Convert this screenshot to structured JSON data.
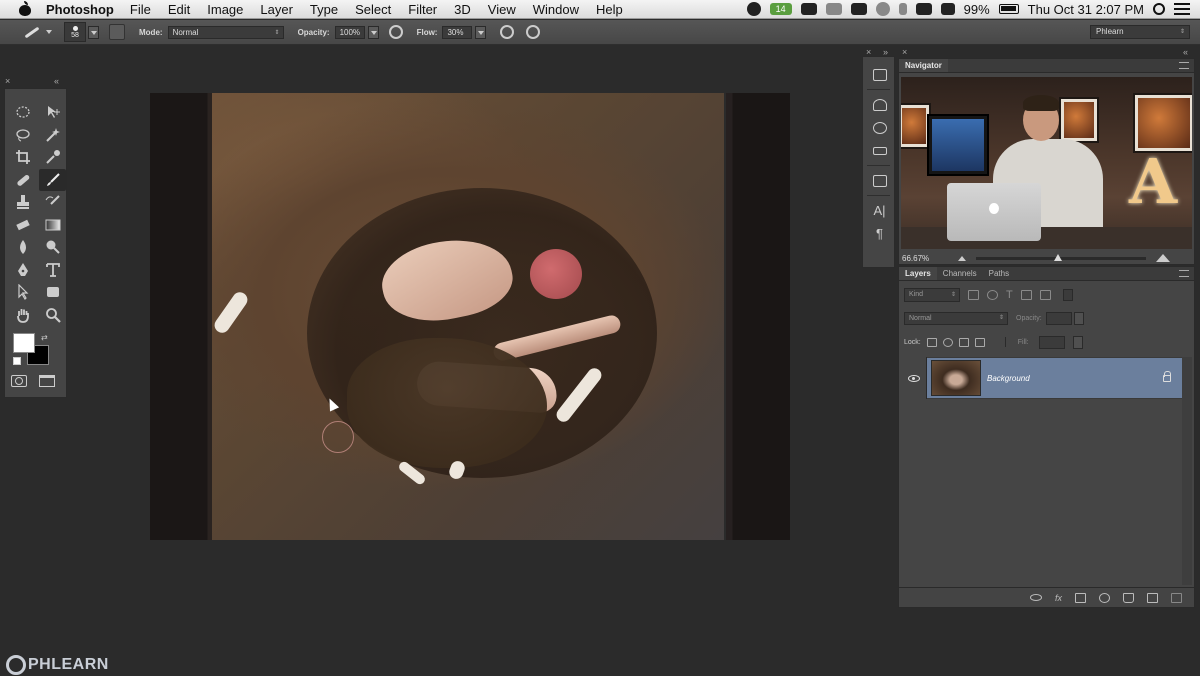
{
  "menubar": {
    "app_name": "Photoshop",
    "items": [
      "File",
      "Edit",
      "Image",
      "Layer",
      "Type",
      "Select",
      "Filter",
      "3D",
      "View",
      "Window",
      "Help"
    ],
    "status_badge": "14",
    "battery": "99%",
    "clock": "Thu Oct 31  2:07 PM"
  },
  "options": {
    "brush_size": "58",
    "mode_label": "Mode:",
    "mode_value": "Normal",
    "opacity_label": "Opacity:",
    "opacity_value": "100%",
    "flow_label": "Flow:",
    "flow_value": "30%",
    "workspace": "Phlearn"
  },
  "toolbox": {
    "tools": [
      "marquee-tool-icon",
      "move-tool-icon",
      "lasso-tool-icon",
      "magic-wand-tool-icon",
      "crop-tool-icon",
      "eyedropper-tool-icon",
      "healing-brush-tool-icon",
      "brush-tool-icon",
      "clone-stamp-tool-icon",
      "history-brush-tool-icon",
      "eraser-tool-icon",
      "gradient-tool-icon",
      "blur-tool-icon",
      "dodge-tool-icon",
      "pen-tool-icon",
      "type-tool-icon",
      "path-selection-tool-icon",
      "shape-tool-icon",
      "hand-tool-icon",
      "zoom-tool-icon"
    ],
    "active_tool": "brush-tool-icon",
    "foreground_color": "#ffffff",
    "background_color": "#000000"
  },
  "navigator": {
    "tab_label": "Navigator",
    "zoom": "66.67%",
    "zoom_slider_fraction": 0.46
  },
  "layers_panel": {
    "tabs": [
      "Layers",
      "Channels",
      "Paths"
    ],
    "kind_label": "Kind",
    "blend_mode": "Normal",
    "opacity_label": "Opacity:",
    "lock_label": "Lock:",
    "fill_label": "Fill:",
    "layers": [
      {
        "name": "Background",
        "visible": true,
        "locked": true,
        "selected": true
      }
    ]
  },
  "colors": {
    "selected_layer": "#6b7f9d",
    "panel_bg": "#454545",
    "workspace_bg": "#2b2b2b"
  },
  "watermark": {
    "text": "PHLEARN"
  }
}
